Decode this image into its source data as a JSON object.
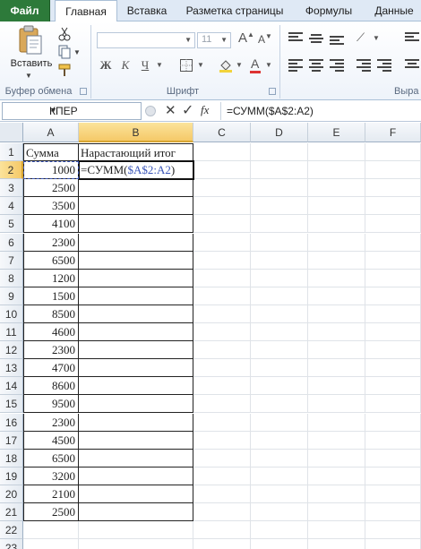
{
  "tabs": [
    "Файл",
    "Главная",
    "Вставка",
    "Разметка страницы",
    "Формулы",
    "Данные"
  ],
  "ribbon": {
    "paste_label": "Вставить",
    "group_clipboard": "Буфер обмена",
    "group_font": "Шрифт",
    "group_align": "Выра",
    "font_size": "11",
    "bold": "Ж",
    "italic": "К",
    "underline": "Ч"
  },
  "formula_bar": {
    "name_box": "КПЕР",
    "fx": "fx",
    "formula": "=СУММ($A$2:A2)"
  },
  "columns": [
    "A",
    "B",
    "C",
    "D",
    "E",
    "F"
  ],
  "rows": [
    "1",
    "2",
    "3",
    "4",
    "5",
    "6",
    "7",
    "8",
    "9",
    "10",
    "11",
    "12",
    "13",
    "14",
    "15",
    "16",
    "17",
    "18",
    "19",
    "20",
    "21",
    "22",
    "23"
  ],
  "header_a": "Сумма",
  "header_b": "Нарастающий итог",
  "values": [
    "1000",
    "2500",
    "3500",
    "4100",
    "2300",
    "6500",
    "1200",
    "1500",
    "8500",
    "4600",
    "2300",
    "4700",
    "8600",
    "9500",
    "2300",
    "4500",
    "6500",
    "3200",
    "2100",
    "2500"
  ],
  "edit_cell": {
    "prefix": "=СУММ(",
    "ref": "$A$2:A2",
    "suffix": ")"
  }
}
